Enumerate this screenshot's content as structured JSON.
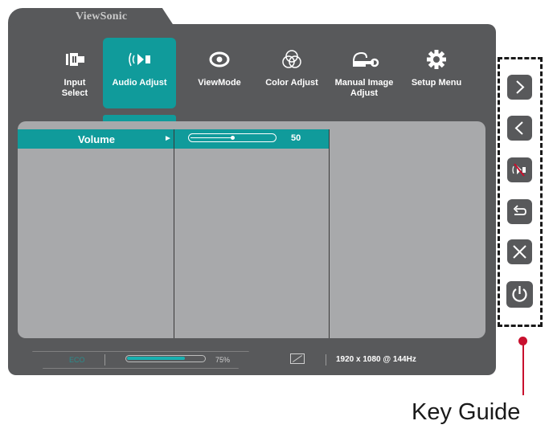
{
  "brand": "ViewSonic",
  "menu": [
    {
      "label": "Input\nSelect",
      "icon": "input-select-icon",
      "active": false
    },
    {
      "label": "Audio Adjust",
      "icon": "speaker-icon",
      "active": true
    },
    {
      "label": "ViewMode",
      "icon": "eye-icon",
      "active": false
    },
    {
      "label": "Color Adjust",
      "icon": "color-circles-icon",
      "active": false
    },
    {
      "label": "Manual Image\nAdjust",
      "icon": "wrench-icon",
      "active": false
    },
    {
      "label": "Setup Menu",
      "icon": "gear-icon",
      "active": false
    }
  ],
  "submenu": {
    "item_label": "Volume",
    "arrow": "►",
    "volume_value": "50",
    "volume_level": 0.5
  },
  "status": {
    "eco_label": "ECO",
    "brightness_percent": "75%",
    "brightness_level": 0.75,
    "resolution": "1920 x 1080 @ 144Hz"
  },
  "keys": [
    {
      "name": "right-arrow-key",
      "icon": "chevron-right-icon"
    },
    {
      "name": "left-arrow-key",
      "icon": "chevron-left-icon"
    },
    {
      "name": "mute-key",
      "icon": "mute-icon"
    },
    {
      "name": "return-key",
      "icon": "return-icon"
    },
    {
      "name": "close-key",
      "icon": "close-icon"
    },
    {
      "name": "power-key",
      "icon": "power-icon"
    }
  ],
  "key_guide_label": "Key Guide",
  "colors": {
    "accent": "#109b9b",
    "panel": "#58595b",
    "content": "#a8a9ab",
    "callout": "#c8102e"
  }
}
